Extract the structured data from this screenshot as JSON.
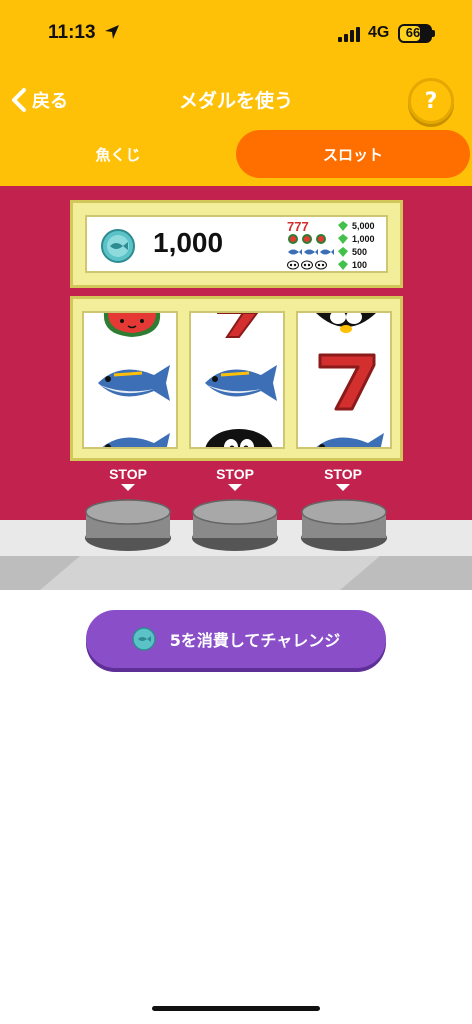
{
  "status_bar": {
    "time": "11:13",
    "network": "4G",
    "battery": "66"
  },
  "header": {
    "back_label": "戻る",
    "title": "メダルを使う",
    "help_label": "?"
  },
  "tabs": [
    {
      "label": "魚くじ",
      "selected": false
    },
    {
      "label": "スロット",
      "selected": true
    }
  ],
  "slot": {
    "medal_count": "1,000",
    "payouts": [
      {
        "symbols": "seven-seven-seven",
        "value": "5,000"
      },
      {
        "symbols": "watermelon-x3",
        "value": "1,000"
      },
      {
        "symbols": "fish-x3",
        "value": "500"
      },
      {
        "symbols": "penguin-eyes-x3",
        "value": "100"
      }
    ],
    "reels": [
      [
        "watermelon",
        "fish",
        "fish"
      ],
      [
        "seven",
        "fish",
        "penguin"
      ],
      [
        "penguin",
        "seven",
        "fish"
      ]
    ],
    "stop_labels": [
      "STOP",
      "STOP",
      "STOP"
    ]
  },
  "cta": {
    "label": "5を消費してチャレンジ"
  },
  "colors": {
    "header": "#FFC107",
    "tab_active": "#FF6F00",
    "slot_bg": "#C2234E",
    "cta": "#8A4FC8"
  }
}
